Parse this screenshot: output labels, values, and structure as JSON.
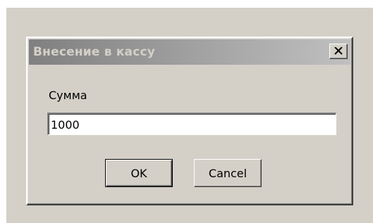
{
  "dialog": {
    "title": "Внесение в кассу",
    "close_icon": "close-icon",
    "field_label": "Сумма",
    "amount_value": "1000",
    "ok_label": "OK",
    "cancel_label": "Cancel"
  },
  "colors": {
    "window_background": "#d4d0c8",
    "titlebar_inactive_gradient_start": "#808080",
    "titlebar_inactive_gradient_end": "#c0c0c0",
    "title_text": "#d4d0c8"
  }
}
